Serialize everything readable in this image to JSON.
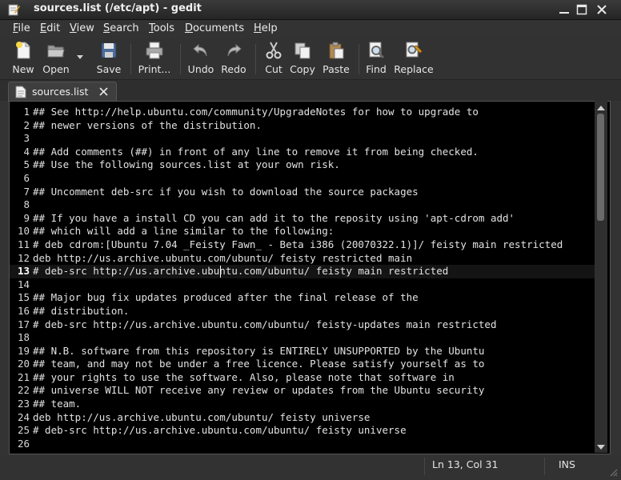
{
  "window": {
    "title": "sources.list (/etc/apt) - gedit"
  },
  "menu": {
    "items": [
      {
        "pre": "",
        "u": "F",
        "post": "ile"
      },
      {
        "pre": "",
        "u": "E",
        "post": "dit"
      },
      {
        "pre": "",
        "u": "V",
        "post": "iew"
      },
      {
        "pre": "",
        "u": "S",
        "post": "earch"
      },
      {
        "pre": "",
        "u": "T",
        "post": "ools"
      },
      {
        "pre": "",
        "u": "D",
        "post": "ocuments"
      },
      {
        "pre": "",
        "u": "H",
        "post": "elp"
      }
    ]
  },
  "toolbar": {
    "new": "New",
    "open": "Open",
    "save": "Save",
    "print": "Print...",
    "undo": "Undo",
    "redo": "Redo",
    "cut": "Cut",
    "copy": "Copy",
    "paste": "Paste",
    "find": "Find",
    "replace": "Replace"
  },
  "tab": {
    "label": "sources.list"
  },
  "editor": {
    "current_line": 13,
    "lines": [
      "## See http://help.ubuntu.com/community/UpgradeNotes for how to upgrade to",
      "## newer versions of the distribution.",
      "",
      "## Add comments (##) in front of any line to remove it from being checked.",
      "## Use the following sources.list at your own risk.",
      "",
      "## Uncomment deb-src if you wish to download the source packages",
      "",
      "## If you have a install CD you can add it to the reposity using 'apt-cdrom add'",
      "## which will add a line similar to the following:",
      "# deb cdrom:[Ubuntu 7.04 _Feisty Fawn_ - Beta i386 (20070322.1)]/ feisty main restricted",
      "deb http://us.archive.ubuntu.com/ubuntu/ feisty restricted main",
      "# deb-src http://us.archive.ubuntu.com/ubuntu/ feisty main restricted",
      "",
      "## Major bug fix updates produced after the final release of the",
      "## distribution.",
      "# deb-src http://us.archive.ubuntu.com/ubuntu/ feisty-updates main restricted",
      "",
      "## N.B. software from this repository is ENTIRELY UNSUPPORTED by the Ubuntu",
      "## team, and may not be under a free licence. Please satisfy yourself as to",
      "## your rights to use the software. Also, please note that software in",
      "## universe WILL NOT receive any review or updates from the Ubuntu security",
      "## team.",
      "deb http://us.archive.ubuntu.com/ubuntu/ feisty universe",
      "# deb-src http://us.archive.ubuntu.com/ubuntu/ feisty universe",
      ""
    ]
  },
  "status": {
    "position": "Ln 13, Col 31",
    "mode": "INS"
  },
  "icons": {
    "app": "gedit-icon",
    "new": "new-document-icon",
    "open": "open-folder-icon",
    "save": "floppy-disk-icon",
    "print": "printer-icon",
    "undo": "undo-arrow-icon",
    "redo": "redo-arrow-icon",
    "cut": "scissors-icon",
    "copy": "copy-icon",
    "paste": "clipboard-icon",
    "find": "magnifier-icon",
    "replace": "find-replace-icon"
  }
}
